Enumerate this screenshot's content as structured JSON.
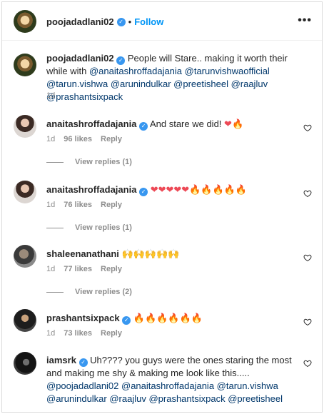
{
  "header": {
    "username": "poojadadlani02",
    "separator": "•",
    "follow_label": "Follow",
    "more_icon": "more-horizontal-icon"
  },
  "caption": {
    "username": "poojadadlani02",
    "text": "People will Stare.. making it worth their while with",
    "mentions_line1": "@anaitashroffadajania @tarunvishwaofficial @tarun.vishwa",
    "mentions_line2": "@arunindulkar @preetisheel @raajluv @prashantsixpack",
    "time": "1d"
  },
  "comments": [
    {
      "username": "anaitashroffadajania",
      "text": "And stare we did!",
      "emoji": "❤🔥",
      "time": "1d",
      "likes": "96 likes",
      "reply_label": "Reply",
      "view_replies": "View replies (1)"
    },
    {
      "username": "anaitashroffadajania",
      "text": "",
      "emoji": "❤❤❤❤❤🔥🔥🔥🔥🔥",
      "time": "1d",
      "likes": "76 likes",
      "reply_label": "Reply",
      "view_replies": "View replies (1)"
    },
    {
      "username": "shaleenanathani",
      "text": "",
      "emoji": "🙌🙌🙌🙌🙌",
      "time": "1d",
      "likes": "77 likes",
      "reply_label": "Reply",
      "view_replies": "View replies (2)"
    },
    {
      "username": "prashantsixpack",
      "text": "",
      "emoji": "🔥🔥🔥🔥🔥🔥",
      "time": "1d",
      "likes": "73 likes",
      "reply_label": "Reply"
    },
    {
      "username": "iamsrk",
      "text": "Uh???? you guys were the ones staring the most and",
      "text_line2": "making me shy & making me look like this.....",
      "mentions_line1": "@poojadadlani02 @anaitashroffadajania @tarun.vishwa",
      "mentions_line2": "@arunindulkar @raajluv @prashantsixpack @preetisheel"
    }
  ],
  "colors": {
    "link_blue": "#0095f6",
    "mention": "#00376b",
    "verified": "#3897f0",
    "muted": "#8e8e8e"
  }
}
